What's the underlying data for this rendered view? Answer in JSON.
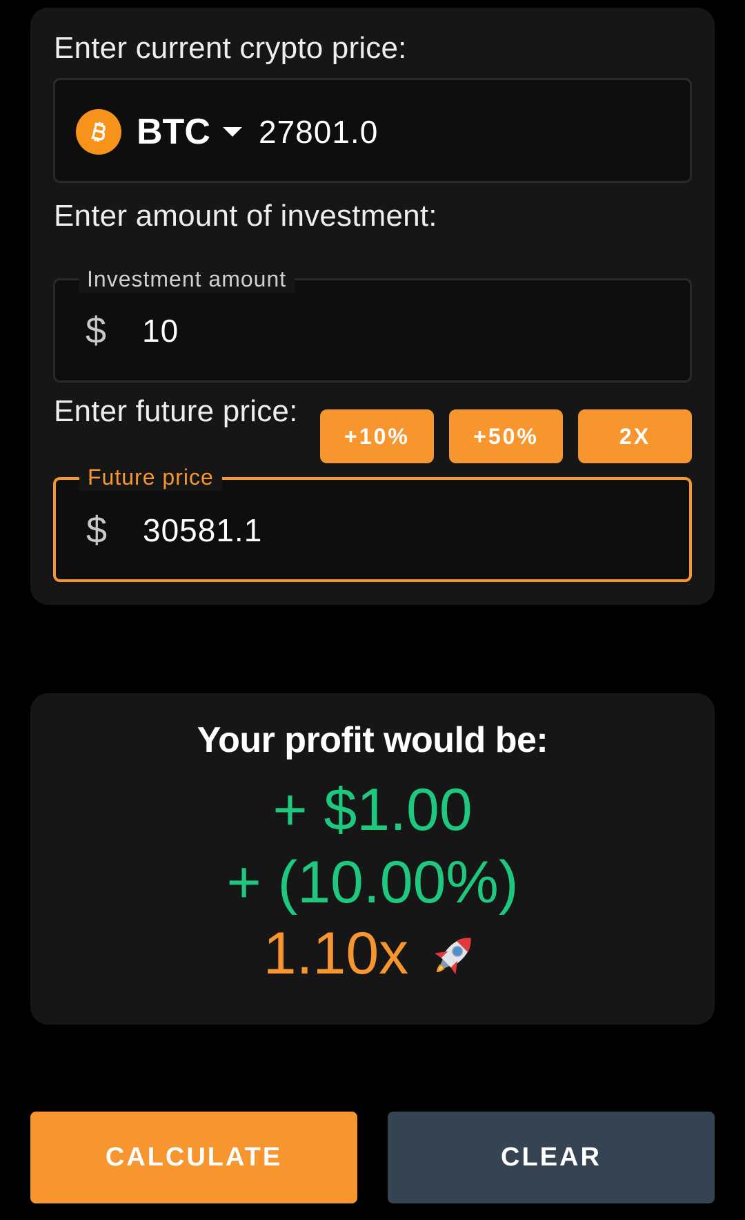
{
  "price_section": {
    "label": "Enter current crypto price:",
    "coin_symbol": "BTC",
    "price_value": "27801.0"
  },
  "investment_section": {
    "label": "Enter amount of investment:",
    "field_legend": "Investment amount",
    "currency_symbol": "$",
    "value": "10"
  },
  "future_section": {
    "label": "Enter future price:",
    "quick_buttons": [
      "+10%",
      "+50%",
      "2X"
    ],
    "field_legend": "Future price",
    "currency_symbol": "$",
    "value": "30581.1"
  },
  "result": {
    "title": "Your profit would be:",
    "profit_amount": "+ $1.00",
    "profit_percent": "+ (10.00%)",
    "multiplier": "1.10x"
  },
  "actions": {
    "calculate_label": "CALCULATE",
    "clear_label": "CLEAR"
  },
  "colors": {
    "accent": "#f7962e",
    "profit_green": "#1ec97f",
    "clear_button": "#354352",
    "card_background": "#161616",
    "bitcoin": "#f7931a"
  },
  "icons": {
    "coin": "bitcoin-icon",
    "dropdown": "caret-down-icon",
    "currency": "dollar-icon",
    "multiplier": "rocket-icon"
  }
}
